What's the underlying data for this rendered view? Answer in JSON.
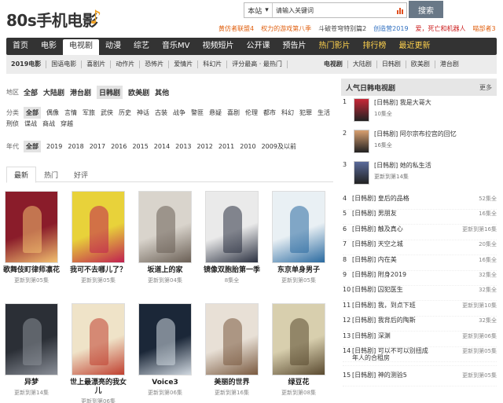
{
  "site": {
    "logo": "80s手机电影"
  },
  "search": {
    "scope": "本站",
    "placeholder": "请输入关键词",
    "button": "搜索"
  },
  "hot_links": [
    {
      "text": "黄仿者联盟4",
      "color": "#e06010"
    },
    {
      "text": "权力的游戏第八季",
      "color": "#e06010"
    },
    {
      "text": "斗破苍穹特别篇2",
      "color": "#444444"
    },
    {
      "text": "创造营2019",
      "color": "#3070c0"
    },
    {
      "text": "爱，死亡和机器人",
      "color": "#cc2020"
    },
    {
      "text": "喵部者3",
      "color": "#e06010"
    }
  ],
  "nav": [
    {
      "label": "首页",
      "state": ""
    },
    {
      "label": "电影",
      "state": ""
    },
    {
      "label": "电视剧",
      "state": "active"
    },
    {
      "label": "动漫",
      "state": ""
    },
    {
      "label": "综艺",
      "state": ""
    },
    {
      "label": "音乐MV",
      "state": ""
    },
    {
      "label": "视频短片",
      "state": ""
    },
    {
      "label": "公开课",
      "state": ""
    },
    {
      "label": "预告片",
      "state": ""
    },
    {
      "label": "热门影片",
      "state": "hl"
    },
    {
      "label": "排行榜",
      "state": "hl"
    },
    {
      "label": "最近更新",
      "state": "hl"
    }
  ],
  "subnav_left": [
    {
      "label": "2019电影",
      "bold": true
    },
    {
      "label": "国语电影"
    },
    {
      "label": "喜剧片"
    },
    {
      "label": "动作片"
    },
    {
      "label": "恐怖片"
    },
    {
      "label": "爱情片"
    },
    {
      "label": "科幻片"
    },
    {
      "label": "评分最高 · 最热门"
    }
  ],
  "subnav_right": [
    {
      "label": "电视剧",
      "bold": true
    },
    {
      "label": "大陆剧"
    },
    {
      "label": "日韩剧"
    },
    {
      "label": "欧美剧"
    },
    {
      "label": "港台剧"
    }
  ],
  "filters": {
    "region": {
      "label": "地区",
      "options": [
        {
          "text": "全部",
          "bold": true
        },
        {
          "text": "大陆剧",
          "bold": true
        },
        {
          "text": "港台剧",
          "bold": true
        },
        {
          "text": "日韩剧",
          "bold": true,
          "selected": true
        },
        {
          "text": "欧美剧",
          "bold": true
        },
        {
          "text": "其他",
          "bold": true
        }
      ]
    },
    "genre": {
      "label": "分类",
      "options": [
        {
          "text": "全部",
          "selected": true
        },
        {
          "text": "偶像"
        },
        {
          "text": "言情"
        },
        {
          "text": "军旅"
        },
        {
          "text": "武侠"
        },
        {
          "text": "历史"
        },
        {
          "text": "神话"
        },
        {
          "text": "古装"
        },
        {
          "text": "战争"
        },
        {
          "text": "警匪"
        },
        {
          "text": "悬疑"
        },
        {
          "text": "喜剧"
        },
        {
          "text": "伦理"
        },
        {
          "text": "都市"
        },
        {
          "text": "科幻"
        },
        {
          "text": "犯罪"
        },
        {
          "text": "生活"
        }
      ]
    },
    "genre2": {
      "options": [
        {
          "text": "刑侦"
        },
        {
          "text": "谍战"
        },
        {
          "text": "商战"
        },
        {
          "text": "穿越"
        }
      ]
    },
    "year": {
      "label": "年代",
      "options": [
        {
          "text": "全部",
          "selected": true
        },
        {
          "text": "2019"
        },
        {
          "text": "2018"
        },
        {
          "text": "2017"
        },
        {
          "text": "2016"
        },
        {
          "text": "2015"
        },
        {
          "text": "2014"
        },
        {
          "text": "2013"
        },
        {
          "text": "2012"
        },
        {
          "text": "2011"
        },
        {
          "text": "2010"
        },
        {
          "text": "2009及以前"
        }
      ]
    }
  },
  "tabs": [
    {
      "label": "最新",
      "active": true
    },
    {
      "label": "热门"
    },
    {
      "label": "好评"
    }
  ],
  "shows": [
    {
      "title": "歌舞伎町律师凛花",
      "status": "更新到第05集",
      "bg": "#8a1c2a",
      "fg": "#f2c070"
    },
    {
      "title": "我可不去哪儿了？",
      "status": "更新到第05集",
      "bg": "#e8d23a",
      "fg": "#c02050"
    },
    {
      "title": "坂道上的家",
      "status": "更新到第04集",
      "bg": "#d9d4cc",
      "fg": "#6a5f55"
    },
    {
      "title": "镜像双胞胎第一季",
      "status": "8集全",
      "bg": "#eaeaea",
      "fg": "#2a3040"
    },
    {
      "title": "东京单身男子",
      "status": "更新到第05集",
      "bg": "#e9f0f4",
      "fg": "#2a6aa0"
    },
    {
      "title": "异梦",
      "status": "更新到第14集",
      "bg": "#2b2f36",
      "fg": "#8a8f98"
    },
    {
      "title": "世上最漂亮的我女儿",
      "status": "更新到第06集",
      "bg": "#efe3c8",
      "fg": "#c04030"
    },
    {
      "title": "Voice3",
      "status": "更新到第06集",
      "bg": "#1b2738",
      "fg": "#d0d8e0"
    },
    {
      "title": "美丽的世界",
      "status": "更新到第16集",
      "bg": "#e8e0d6",
      "fg": "#7a5a40"
    },
    {
      "title": "绿豆花",
      "status": "更新到第08集",
      "bg": "#d8cfae",
      "fg": "#5a4a30"
    }
  ],
  "panel": {
    "title": "人气日韩电视剧",
    "more": "更多",
    "top": [
      {
        "rank": "1",
        "name": "[日韩剧] 我是大哥大",
        "status": "10集全",
        "bg": "#c82838"
      },
      {
        "rank": "2",
        "name": "[日韩剧] 阿尔宗布拉宫的回忆",
        "status": "16集全",
        "bg": "#d8a070"
      },
      {
        "rank": "3",
        "name": "[日韩剧] 她的私生活",
        "status": "更新到第14集",
        "bg": "#5a6a9a"
      }
    ],
    "list": [
      {
        "rank": "4",
        "name": "[日韩剧] 皇后的品格",
        "status": "52集全"
      },
      {
        "rank": "5",
        "name": "[日韩剧] 男朋友",
        "status": "16集全"
      },
      {
        "rank": "6",
        "name": "[日韩剧] 触及真心",
        "status": "更新到第16集"
      },
      {
        "rank": "7",
        "name": "[日韩剧] 天空之城",
        "status": "20集全"
      },
      {
        "rank": "8",
        "name": "[日韩剧] 内在美",
        "status": "16集全"
      },
      {
        "rank": "9",
        "name": "[日韩剧] 附身2019",
        "status": "32集全"
      },
      {
        "rank": "10",
        "name": "[日韩剧] 囚犯医生",
        "status": "32集全"
      },
      {
        "rank": "11",
        "name": "[日韩剧] 我，到点下班",
        "status": "更新到第10集"
      },
      {
        "rank": "12",
        "name": "[日韩剧] 我背后的陶斯",
        "status": "32集全"
      },
      {
        "rank": "13",
        "name": "[日韩剧] 深渊",
        "status": "更新到第06集"
      },
      {
        "rank": "14",
        "name": "[日韩剧] 可以不可以别扭成",
        "status": "更新到第05集"
      },
      {
        "rank": "",
        "name": "年人的合租房",
        "status": ""
      },
      {
        "rank": "15",
        "name": "[日韩剧] 神的测验5",
        "status": "更新到第05集"
      }
    ]
  }
}
